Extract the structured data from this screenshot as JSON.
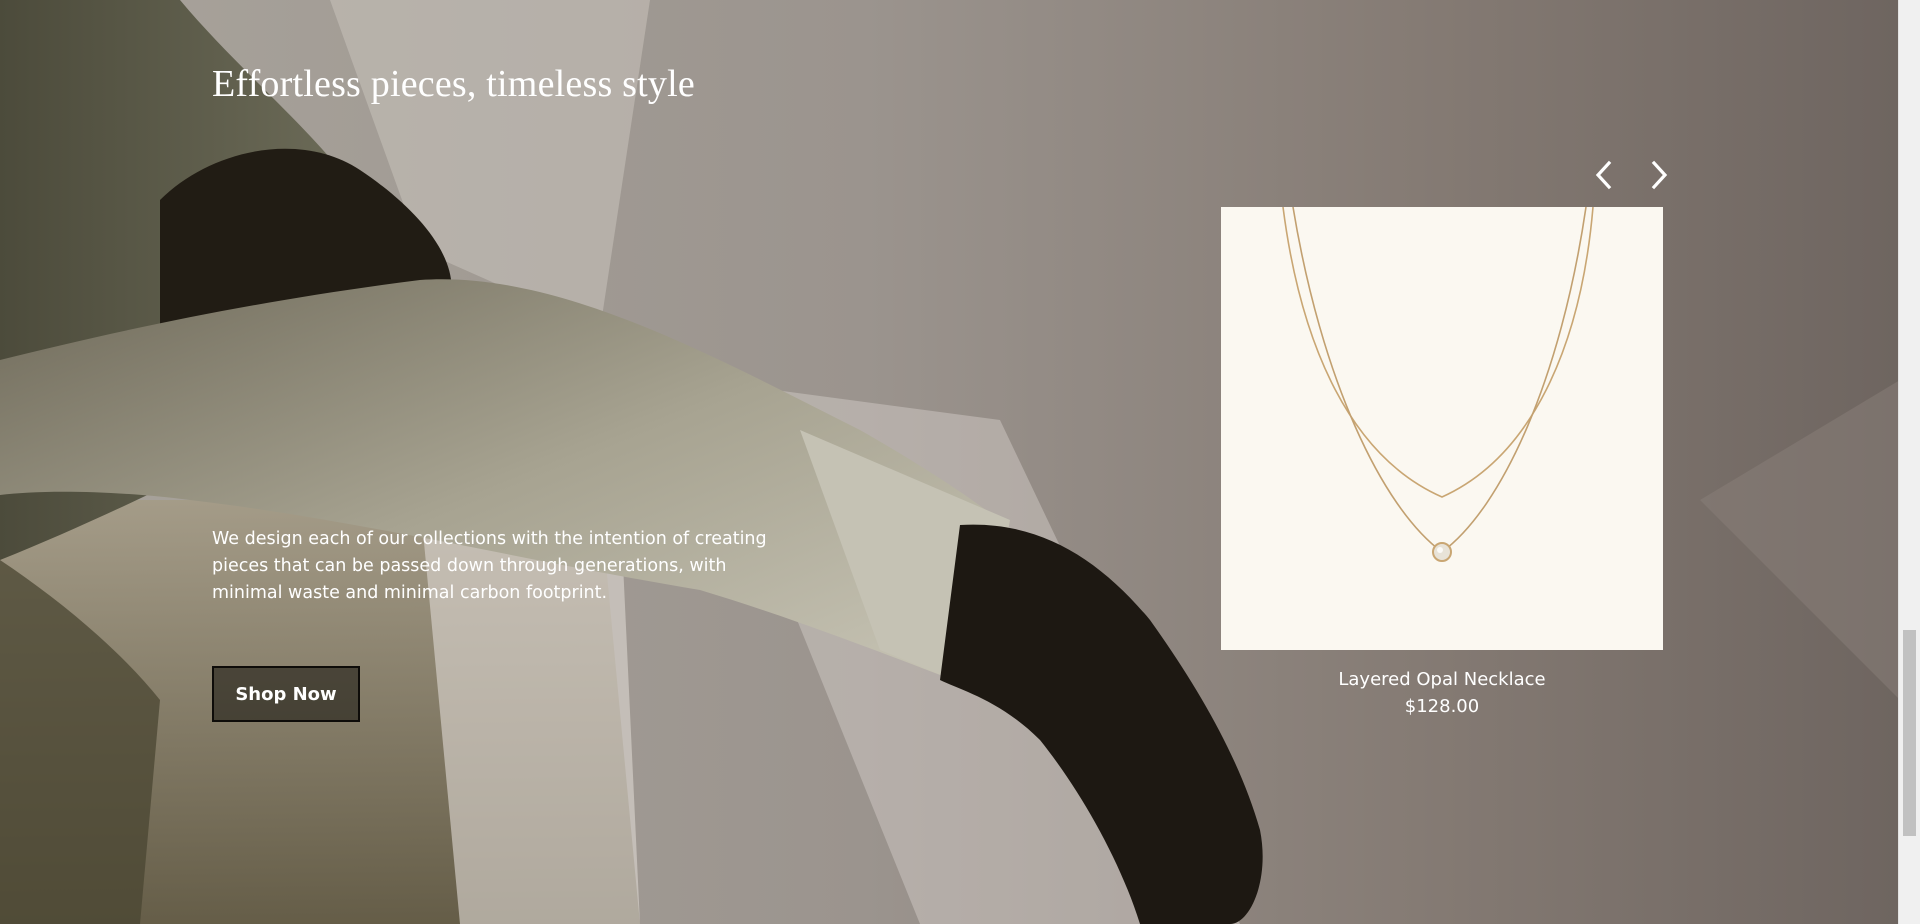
{
  "hero": {
    "title": "Effortless pieces, timeless style",
    "body": "We design each of our collections with the intention of creating pieces that can be passed down through generations, with minimal waste and minimal carbon footprint.",
    "cta_label": "Shop Now"
  },
  "carousel": {
    "prev_icon": "chevron-left-icon",
    "next_icon": "chevron-right-icon",
    "product": {
      "name": "Layered Opal Necklace",
      "price": "$128.00",
      "image_bg": "#fbf8f1"
    }
  },
  "colors": {
    "text": "#ffffff",
    "button_border": "#0e0c09",
    "product_bg": "#fbf8f1"
  }
}
